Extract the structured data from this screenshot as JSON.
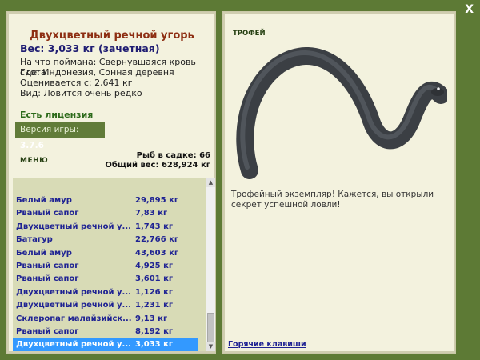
{
  "window": {
    "close_label": "X"
  },
  "fish": {
    "title": "Двухцветный речной угорь",
    "weight": "Вес: 3,033 кг (зачетная)",
    "info": [
      "На что поймана: Свернувшаяся кровь скота",
      "Где: Индонезия, Сонная деревня",
      "Оценивается с: 2,641 кг",
      "Вид: Ловится очень редко"
    ]
  },
  "license": "Есть лицензия",
  "version": {
    "label": "Версия игры: ",
    "value": "3.7.6"
  },
  "menu_label": "МЕНЮ",
  "stats": {
    "fish_in_cage": "Рыб в садке: 66",
    "total_weight": "Общий вес: 628,924 кг"
  },
  "catch_list": [
    {
      "name": "Белый амур",
      "weight": "29,895 кг"
    },
    {
      "name": "Рваный сапог",
      "weight": "7,83 кг"
    },
    {
      "name": "Двухцветный речной у...",
      "weight": "1,743 кг"
    },
    {
      "name": "Батагур",
      "weight": "22,766 кг"
    },
    {
      "name": "Белый амур",
      "weight": "43,603 кг"
    },
    {
      "name": "Рваный сапог",
      "weight": "4,925 кг"
    },
    {
      "name": "Рваный сапог",
      "weight": "3,601 кг"
    },
    {
      "name": "Двухцветный речной у...",
      "weight": "1,126 кг"
    },
    {
      "name": "Двухцветный речной у...",
      "weight": "1,231 кг"
    },
    {
      "name": "Склеропаг малайзийск...",
      "weight": "9,13 кг"
    },
    {
      "name": "Рваный сапог",
      "weight": "8,192 кг"
    },
    {
      "name": "Двухцветный речной у...",
      "weight": "3,033 кг",
      "selected": true
    }
  ],
  "trophy": {
    "label": "ТРОФЕЙ",
    "description": "Трофейный экземпляр! Кажется, вы открыли секрет успешной ловли!"
  },
  "hotkeys_label": "Горячие клавиши",
  "colors": {
    "background": "#5d7a35",
    "panel": "#f3f2de",
    "selection": "#3399ff",
    "title": "#8d2e12",
    "link": "#1f2393"
  }
}
